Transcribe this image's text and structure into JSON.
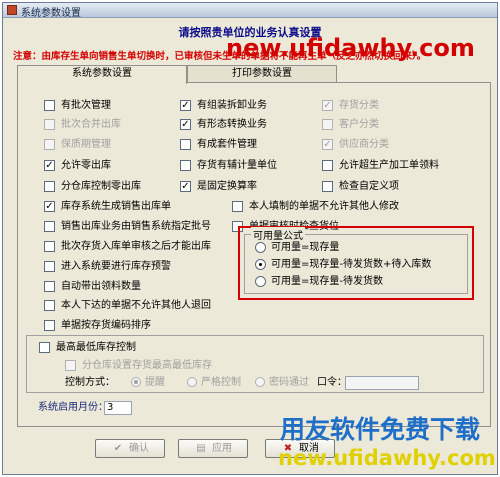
{
  "window": {
    "title": "系统参数设置"
  },
  "heading": "请按照贵单位的业务认真设置",
  "notice": "注意：由库存生单向销售生单切换时，已审核但未生单的单据将不能再生单（反之亦然切换回来）。",
  "tabs": [
    {
      "label": "系统参数设置",
      "active": true
    },
    {
      "label": "打印参数设置",
      "active": false
    }
  ],
  "options": {
    "col1": [
      {
        "label": "有批次管理",
        "checked": false,
        "disabled": false
      },
      {
        "label": "批次合并出库",
        "checked": false,
        "disabled": true
      },
      {
        "label": "保质期管理",
        "checked": false,
        "disabled": true
      },
      {
        "label": "允许零出库",
        "checked": true,
        "disabled": false
      },
      {
        "label": "分仓库控制零出库",
        "checked": false,
        "disabled": false
      },
      {
        "label": "库存系统生成销售出库单",
        "checked": true,
        "disabled": false
      },
      {
        "label": "销售出库业务由销售系统指定批号",
        "checked": false,
        "disabled": false
      },
      {
        "label": "批次存货入库单审核之后才能出库",
        "checked": false,
        "disabled": false
      },
      {
        "label": "进入系统要进行库存预警",
        "checked": false,
        "disabled": false
      },
      {
        "label": "自动带出领料数量",
        "checked": false,
        "disabled": false
      },
      {
        "label": "本人下达的单据不允许其他人退回",
        "checked": false,
        "disabled": false
      },
      {
        "label": "单据按存货编码排序",
        "checked": false,
        "disabled": false
      }
    ],
    "col2": [
      {
        "label": "有组装拆卸业务",
        "checked": true,
        "disabled": false
      },
      {
        "label": "有形态转换业务",
        "checked": true,
        "disabled": false
      },
      {
        "label": "有成套件管理",
        "checked": false,
        "disabled": false
      },
      {
        "label": "存货有辅计量单位",
        "checked": false,
        "disabled": false
      },
      {
        "label": "是固定换算率",
        "checked": true,
        "disabled": false
      }
    ],
    "col2b": [
      {
        "label": "本人填制的单据不允许其他人修改",
        "checked": false,
        "disabled": false
      },
      {
        "label": "单据审核时检查货位",
        "checked": false,
        "disabled": false
      }
    ],
    "col3": [
      {
        "label": "存货分类",
        "checked": true,
        "disabled": true
      },
      {
        "label": "客户分类",
        "checked": false,
        "disabled": true
      },
      {
        "label": "供应商分类",
        "checked": true,
        "disabled": true
      },
      {
        "label": "允许超生产加工单领料",
        "checked": false,
        "disabled": false
      },
      {
        "label": "检查自定义项",
        "checked": false,
        "disabled": false
      }
    ]
  },
  "available": {
    "title": "可用量公式",
    "options": [
      {
        "label": "可用量=现存量",
        "selected": false
      },
      {
        "label": "可用量=现存量-待发货数+待入库数",
        "selected": true
      },
      {
        "label": "可用量=现存量-待发货数",
        "selected": false
      }
    ]
  },
  "stock_control": {
    "checkbox": "最高最低库存控制",
    "sub_checkbox": "分仓库设置存货最高最低库存",
    "method_label": "控制方式：",
    "methods": [
      {
        "label": "提醒",
        "selected": true
      },
      {
        "label": "严格控制",
        "selected": false
      },
      {
        "label": "密码通过",
        "selected": false
      }
    ],
    "password_label": "口令：",
    "password_value": ""
  },
  "start_month": {
    "label": "系统启用月份：",
    "value": "3"
  },
  "buttons": {
    "confirm": "确认",
    "apply": "应用",
    "cancel": "取消"
  },
  "watermarks": {
    "top": "new.ufidawhy.com",
    "bottom_cn": "用友软件免费下载",
    "bottom_url": "new.ufidawhy.com"
  },
  "colors": {
    "heading": "#0d0d8c",
    "notice": "#d40000",
    "highlight_frame": "#d40000",
    "watermark_blue": "#1f6ec8",
    "watermark_yellow": "#e0d000"
  }
}
